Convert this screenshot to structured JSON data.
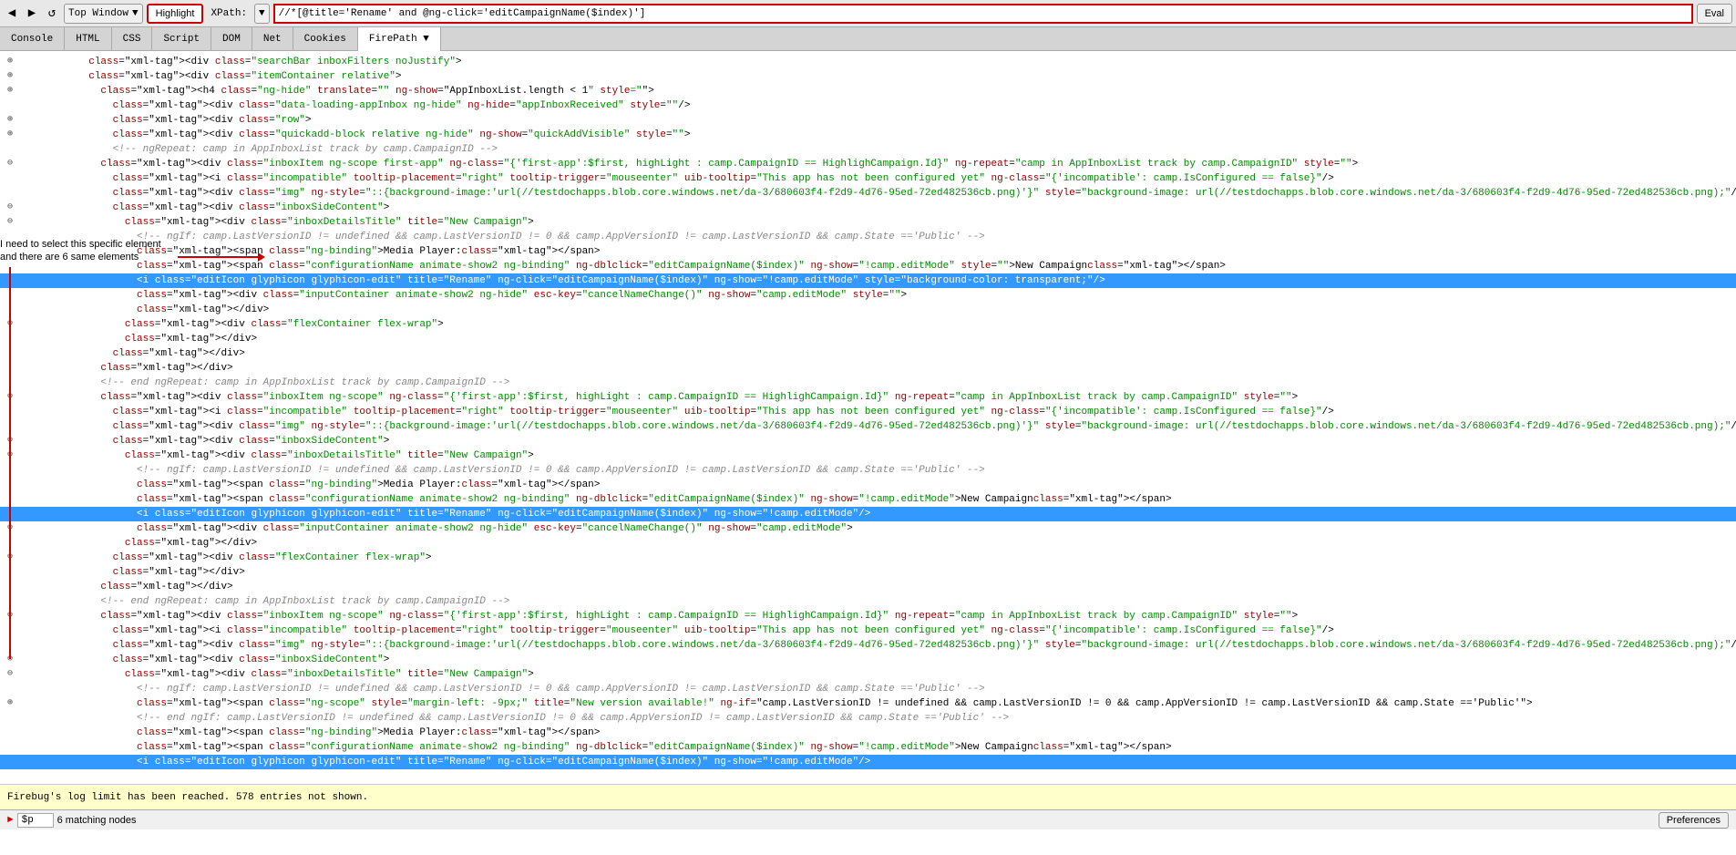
{
  "toolbar": {
    "window_label": "Top Window",
    "highlight_label": "Highlight",
    "xpath_label": "XPath:",
    "firepath_input_value": "//*[@title='Rename' and @ng-click='editCampaignName($index)']",
    "eval_label": "Eval",
    "firepath_tab": "FirePath ▼"
  },
  "tabs": [
    {
      "label": "Console",
      "active": false
    },
    {
      "label": "HTML",
      "active": false
    },
    {
      "label": "CSS",
      "active": false
    },
    {
      "label": "Script",
      "active": false
    },
    {
      "label": "DOM",
      "active": false
    },
    {
      "label": "Net",
      "active": false
    },
    {
      "label": "Cookies",
      "active": false
    },
    {
      "label": "FirePath",
      "active": true
    }
  ],
  "annotation": {
    "text1": "I need to select this specific element",
    "text2": "and there are 6 same elements"
  },
  "status_bar": {
    "text": "Firebug's log limit has been reached. 578 entries not shown."
  },
  "bottom_bar": {
    "input_value": "$p",
    "matching_nodes": "6 matching nodes",
    "preferences_label": "Preferences"
  },
  "code_lines": [
    {
      "indent": 6,
      "expand": "+",
      "content": "<div class=\"searchBar inboxFilters noJustify\">",
      "highlighted": false
    },
    {
      "indent": 6,
      "expand": "+",
      "content": "<div class=\"itemContainer relative\">",
      "highlighted": false
    },
    {
      "indent": 7,
      "expand": "+",
      "content": "<h4 class=\"ng-hide\" translate=\"\" ng-show=\"AppInboxList.length < 1\" style=\"\">",
      "highlighted": false
    },
    {
      "indent": 8,
      "expand": " ",
      "content": "<div class=\"data-loading-appInbox ng-hide\" ng-hide=\"appInboxReceived\" style=\"\"/>",
      "highlighted": false
    },
    {
      "indent": 8,
      "expand": "+",
      "content": "<div class=\"row\">",
      "highlighted": false
    },
    {
      "indent": 8,
      "expand": "+",
      "content": "<div class=\"quickadd-block relative ng-hide\" ng-show=\"quickAddVisible\" style=\"\">",
      "highlighted": false
    },
    {
      "indent": 8,
      "expand": " ",
      "content": "<!-- ngRepeat: camp in AppInboxList track by camp.CampaignID -->",
      "highlighted": false,
      "is_comment": true
    },
    {
      "indent": 7,
      "expand": "-",
      "content": "<div class=\"inboxItem ng-scope first-app\" ng-class=\"{'first-app':$first, highLight : camp.CampaignID == HighlighCampaign.Id}\" ng-repeat=\"camp in AppInboxList track by camp.CampaignID\" style=\"\">",
      "highlighted": false
    },
    {
      "indent": 8,
      "expand": " ",
      "content": "<i class=\"incompatible\" tooltip-placement=\"right\" tooltip-trigger=\"mouseenter\" uib-tooltip=\"This app has not been configured yet\" ng-class=\"{'incompatible': camp.IsConfigured == false}\"/>",
      "highlighted": false
    },
    {
      "indent": 8,
      "expand": " ",
      "content": "<div class=\"img\" ng-style=\"::{background-image:'url(//testdochapps.blob.core.windows.net/da-3/680603f4-f2d9-4d76-95ed-72ed482536cb.png)'}\" style=\"background-image: url(//testdochapps.blob.core.windows.net/da-3/680603f4-f2d9-4d76-95ed-72ed482536cb.png);\"/>",
      "highlighted": false
    },
    {
      "indent": 8,
      "expand": "-",
      "content": "<div class=\"inboxSideContent\">",
      "highlighted": false
    },
    {
      "indent": 9,
      "expand": "-",
      "content": "<div class=\"inboxDetailsTitle\" title=\"New Campaign\">",
      "highlighted": false
    },
    {
      "indent": 10,
      "expand": " ",
      "content": "<!-- ngIf: camp.LastVersionID != undefined && camp.LastVersionID != 0 && camp.AppVersionID != camp.LastVersionID && camp.State =='Public' -->",
      "highlighted": false,
      "is_comment": true
    },
    {
      "indent": 10,
      "expand": " ",
      "content": "<span class=\"ng-binding\">Media Player:</span>",
      "highlighted": false
    },
    {
      "indent": 10,
      "expand": " ",
      "content": "<span class=\"configurationName animate-show2 ng-binding\" ng-dblclick=\"editCampaignName($index)\" ng-show=\"!camp.editMode\" style=\"\">New Campaign</span>",
      "highlighted": false
    },
    {
      "indent": 10,
      "expand": " ",
      "content": "<i class=\"editIcon glyphicon glyphicon-edit\" title=\"Rename\" ng-click=\"editCampaignName($index)\" ng-show=\"!camp.editMode\" style=\"background-color: transparent;\"/>",
      "highlighted": true
    },
    {
      "indent": 10,
      "expand": " ",
      "content": "<div class=\"inputContainer animate-show2 ng-hide\" esc-key=\"cancelNameChange()\" ng-show=\"camp.editMode\" style=\"\">",
      "highlighted": false
    },
    {
      "indent": 10,
      "expand": " ",
      "content": "</div>",
      "highlighted": false
    },
    {
      "indent": 9,
      "expand": "+",
      "content": "<div class=\"flexContainer flex-wrap\">",
      "highlighted": false
    },
    {
      "indent": 9,
      "expand": " ",
      "content": "</div>",
      "highlighted": false
    },
    {
      "indent": 8,
      "expand": " ",
      "content": "</div>",
      "highlighted": false
    },
    {
      "indent": 7,
      "expand": " ",
      "content": "</div>",
      "highlighted": false
    },
    {
      "indent": 7,
      "expand": " ",
      "content": "<!-- end ngRepeat: camp in AppInboxList track by camp.CampaignID -->",
      "highlighted": false,
      "is_comment": true
    },
    {
      "indent": 7,
      "expand": "-",
      "content": "<div class=\"inboxItem ng-scope\" ng-class=\"{'first-app':$first, highLight : camp.CampaignID == HighlighCampaign.Id}\" ng-repeat=\"camp in AppInboxList track by camp.CampaignID\" style=\"\">",
      "highlighted": false
    },
    {
      "indent": 8,
      "expand": " ",
      "content": "<i class=\"incompatible\" tooltip-placement=\"right\" tooltip-trigger=\"mouseenter\" uib-tooltip=\"This app has not been configured yet\" ng-class=\"{'incompatible': camp.IsConfigured == false}\"/>",
      "highlighted": false
    },
    {
      "indent": 8,
      "expand": " ",
      "content": "<div class=\"img\" ng-style=\"::{background-image:'url(//testdochapps.blob.core.windows.net/da-3/680603f4-f2d9-4d76-95ed-72ed482536cb.png)'}\" style=\"background-image: url(//testdochapps.blob.core.windows.net/da-3/680603f4-f2d9-4d76-95ed-72ed482536cb.png);\"/>",
      "highlighted": false
    },
    {
      "indent": 8,
      "expand": "-",
      "content": "<div class=\"inboxSideContent\">",
      "highlighted": false
    },
    {
      "indent": 9,
      "expand": "-",
      "content": "<div class=\"inboxDetailsTitle\" title=\"New Campaign\">",
      "highlighted": false
    },
    {
      "indent": 10,
      "expand": " ",
      "content": "<!-- ngIf: camp.LastVersionID != undefined && camp.LastVersionID != 0 && camp.AppVersionID != camp.LastVersionID && camp.State =='Public' -->",
      "highlighted": false,
      "is_comment": true
    },
    {
      "indent": 10,
      "expand": " ",
      "content": "<span class=\"ng-binding\">Media Player:</span>",
      "highlighted": false
    },
    {
      "indent": 10,
      "expand": " ",
      "content": "<span class=\"configurationName animate-show2 ng-binding\" ng-dblclick=\"editCampaignName($index)\" ng-show=\"!camp.editMode\">New Campaign</span>",
      "highlighted": false
    },
    {
      "indent": 10,
      "expand": " ",
      "content": "<i class=\"editIcon glyphicon glyphicon-edit\" title=\"Rename\" ng-click=\"editCampaignName($index)\" ng-show=\"!camp.editMode\"/>",
      "highlighted": true
    },
    {
      "indent": 10,
      "expand": "+",
      "content": "<div class=\"inputContainer animate-show2 ng-hide\" esc-key=\"cancelNameChange()\" ng-show=\"camp.editMode\">",
      "highlighted": false
    },
    {
      "indent": 9,
      "expand": " ",
      "content": "</div>",
      "highlighted": false
    },
    {
      "indent": 8,
      "expand": "+",
      "content": "<div class=\"flexContainer flex-wrap\">",
      "highlighted": false
    },
    {
      "indent": 8,
      "expand": " ",
      "content": "</div>",
      "highlighted": false
    },
    {
      "indent": 7,
      "expand": " ",
      "content": "</div>",
      "highlighted": false
    },
    {
      "indent": 7,
      "expand": " ",
      "content": "<!-- end ngRepeat: camp in AppInboxList track by camp.CampaignID -->",
      "highlighted": false,
      "is_comment": true
    },
    {
      "indent": 7,
      "expand": "-",
      "content": "<div class=\"inboxItem ng-scope\" ng-class=\"{'first-app':$first, highLight : camp.CampaignID == HighlighCampaign.Id}\" ng-repeat=\"camp in AppInboxList track by camp.CampaignID\" style=\"\">",
      "highlighted": false
    },
    {
      "indent": 8,
      "expand": " ",
      "content": "<i class=\"incompatible\" tooltip-placement=\"right\" tooltip-trigger=\"mouseenter\" uib-tooltip=\"This app has not been configured yet\" ng-class=\"{'incompatible': camp.IsConfigured == false}\"/>",
      "highlighted": false
    },
    {
      "indent": 8,
      "expand": " ",
      "content": "<div class=\"img\" ng-style=\"::{background-image:'url(//testdochapps.blob.core.windows.net/da-3/680603f4-f2d9-4d76-95ed-72ed482536cb.png)'}\" style=\"background-image: url(//testdochapps.blob.core.windows.net/da-3/680603f4-f2d9-4d76-95ed-72ed482536cb.png);\"/>",
      "highlighted": false
    },
    {
      "indent": 8,
      "expand": "-",
      "content": "<div class=\"inboxSideContent\">",
      "highlighted": false
    },
    {
      "indent": 9,
      "expand": "-",
      "content": "<div class=\"inboxDetailsTitle\" title=\"New Campaign\">",
      "highlighted": false
    },
    {
      "indent": 10,
      "expand": " ",
      "content": "<!-- ngIf: camp.LastVersionID != undefined && camp.LastVersionID != 0 && camp.AppVersionID != camp.LastVersionID && camp.State =='Public' -->",
      "highlighted": false,
      "is_comment": true
    },
    {
      "indent": 10,
      "expand": "+",
      "content": "<span class=\"ng-scope\" style=\"margin-left: -9px;\" title=\"New version available!\" ng-if=\"camp.LastVersionID != undefined && camp.LastVersionID != 0 && camp.AppVersionID != camp.LastVersionID && camp.State =='Public'\">",
      "highlighted": false
    },
    {
      "indent": 10,
      "expand": " ",
      "content": "<!-- end ngIf: camp.LastVersionID != undefined && camp.LastVersionID != 0 && camp.AppVersionID != camp.LastVersionID && camp.State =='Public' -->",
      "highlighted": false,
      "is_comment": true
    },
    {
      "indent": 10,
      "expand": " ",
      "content": "<span class=\"ng-binding\">Media Player:</span>",
      "highlighted": false
    },
    {
      "indent": 10,
      "expand": " ",
      "content": "<span class=\"configurationName animate-show2 ng-binding\" ng-dblclick=\"editCampaignName($index)\" ng-show=\"!camp.editMode\">New Campaign</span>",
      "highlighted": false
    },
    {
      "indent": 10,
      "expand": " ",
      "content": "<i class=\"editIcon glyphicon glyphicon-edit\" title=\"Rename\" ng-click=\"editCampaignName($index)\" ng-show=\"!camp.editMode\"/>",
      "highlighted": true
    }
  ]
}
